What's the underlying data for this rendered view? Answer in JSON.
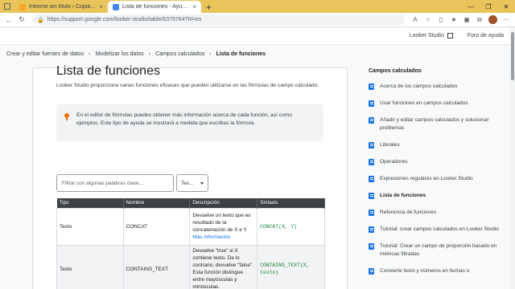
{
  "browser": {
    "tabs": [
      {
        "title": "Informe sin título › Copia de Versi",
        "active": false,
        "close": "×"
      },
      {
        "title": "Lista de funciones - Ayuda de Loo",
        "active": true,
        "close": "×"
      }
    ],
    "new_tab": "+",
    "window_controls": [
      "—",
      "❐",
      "✕"
    ],
    "url": "https://support.google.com/looker-studio/table/6379764?hl=es"
  },
  "site_header": {
    "looker_studio": "Looker Studio",
    "help_forum": "Foro de ayuda"
  },
  "breadcrumb": [
    "Crear y editar fuentes de datos",
    "Modelizar los datos",
    "Campos calculados",
    "Lista de funciones"
  ],
  "breadcrumb_sep": "›",
  "main": {
    "title": "Lista de funciones",
    "intro": "Looker Studio proporciona varias funciones eficaces que pueden utilizarse en las fórmulas de campo calculado.",
    "note": "En el editor de fórmulas puedes obtener más información acerca de cada función, así como ejemplos. Este tipo de ayuda se mostrará a medida que escribas la fórmula.",
    "filter_placeholder": "Filtrar con algunas palabras clave...",
    "type_select": "Tex...",
    "table": {
      "headers": [
        "Tipo",
        "Nombre",
        "Descripción",
        "Sintaxis"
      ],
      "rows": [
        {
          "type": "Texto",
          "name": "CONCAT",
          "description": "Devuelve un texto que es resultado de la concatenación de X e Y.",
          "more": "Más información",
          "syntax": "CONCAT(X, Y)"
        },
        {
          "type": "Texto",
          "name": "CONTAINS_TEXT",
          "description": "Devuelve \"true\" si X contiene texto. De lo contrario, devuelve \"false\". Esta función distingue entre mayúsculas y minúsculas.",
          "syntax": "CONTAINS_TEXT(X, texto)"
        }
      ]
    }
  },
  "sidebar": {
    "heading": "Campos calculados",
    "items": [
      {
        "label": "Acerca de los campos calculados"
      },
      {
        "label": "Usar funciones en campos calculados"
      },
      {
        "label": "Añadir y editar campos calculados y solucionar problemas"
      },
      {
        "label": "Literales"
      },
      {
        "label": "Operadores"
      },
      {
        "label": "Expresiones regulares en Looker Studio"
      },
      {
        "label": "Lista de funciones",
        "active": true
      },
      {
        "label": "Referencia de funciones"
      },
      {
        "label": "Tutorial: crear campos calculados en Looker Studio"
      },
      {
        "label": "Tutorial: Crear un campo de proporción basado en métricas filtradas"
      },
      {
        "label": "Convierte texto y números en fechas o"
      }
    ]
  }
}
